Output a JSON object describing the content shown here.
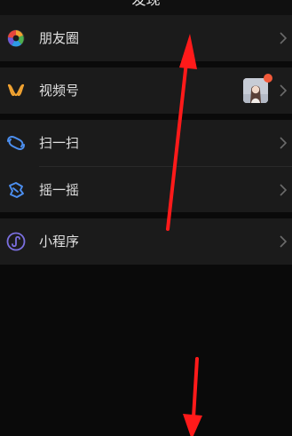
{
  "header": {
    "title": "发现"
  },
  "menu": {
    "moments": {
      "label": "朋友圈",
      "icon": "moments-aperture-icon"
    },
    "channels": {
      "label": "视频号",
      "icon": "channels-icon"
    },
    "scan": {
      "label": "扫一扫",
      "icon": "scan-icon"
    },
    "shake": {
      "label": "摇一摇",
      "icon": "shake-icon"
    },
    "mini_programs": {
      "label": "小程序",
      "icon": "mini-program-icon"
    }
  },
  "colors": {
    "background": "#0a0a0a",
    "row_background": "#1b1b1b",
    "text": "#e0e0e0",
    "chevron": "#6b6b6b",
    "accent_blue": "#4c8ff0",
    "badge_dot": "#f25a3a",
    "annotation_arrow": "#ff1a1a"
  }
}
